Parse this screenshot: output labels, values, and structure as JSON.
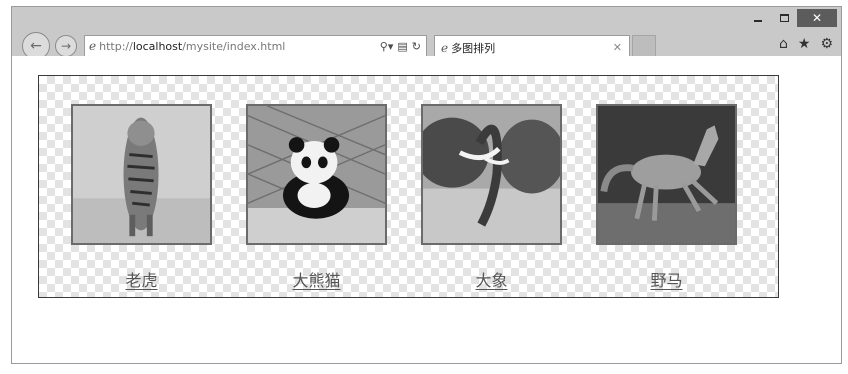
{
  "browser": {
    "address": {
      "prefix": "http://",
      "host": "localhost",
      "path": "/mysite/index.html"
    },
    "tab": {
      "title": "多图排列"
    }
  },
  "gallery": {
    "items": [
      {
        "name": "tiger-photo",
        "caption": "老虎"
      },
      {
        "name": "panda-photo",
        "caption": "大熊猫"
      },
      {
        "name": "elephant-photo",
        "caption": "大象"
      },
      {
        "name": "horse-photo",
        "caption": "野马"
      }
    ]
  },
  "colors": {
    "border": "#3a3a3a",
    "checker": "#e3e3e3",
    "caption": "#555555"
  }
}
